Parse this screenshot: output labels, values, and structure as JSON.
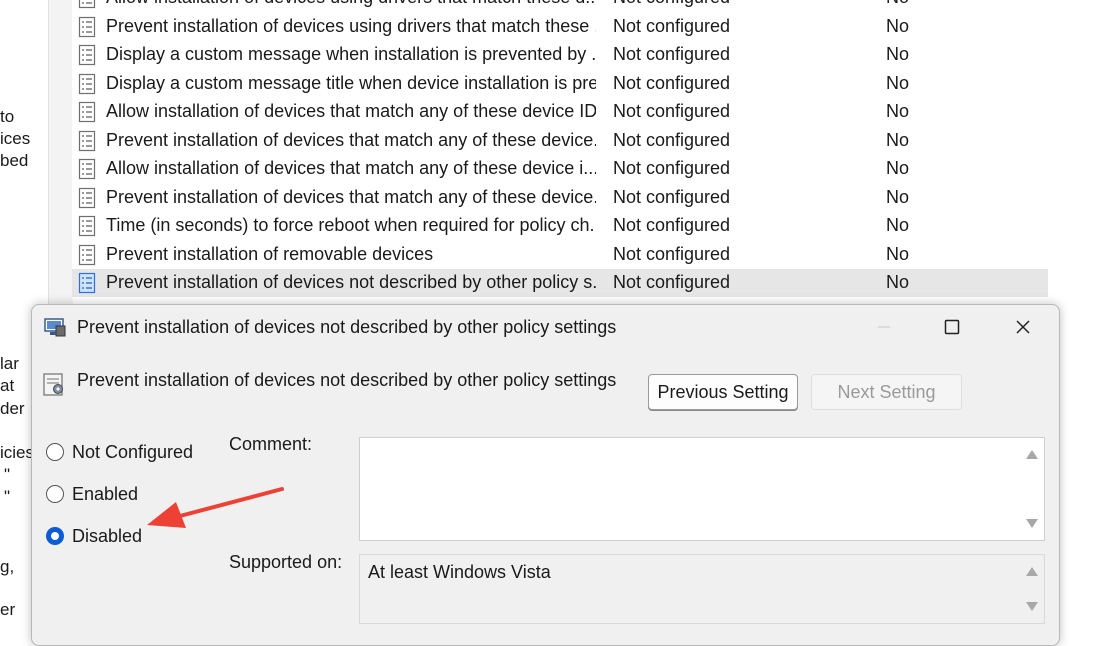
{
  "background_fragments": [
    {
      "text": "to"
    },
    {
      "text": "ices"
    },
    {
      "text": "bed"
    },
    {
      "text": "lar"
    },
    {
      "text": "at"
    },
    {
      "text": "der"
    },
    {
      "text": "icies"
    },
    {
      "text": "\""
    },
    {
      "text": "\""
    },
    {
      "text": "g,"
    },
    {
      "text": "er"
    }
  ],
  "policy_list": {
    "rows": [
      {
        "name": "Allow installation of devices using drivers that match these d...",
        "state": "Not configured",
        "comment": "No"
      },
      {
        "name": "Prevent installation of devices using drivers that match these ...",
        "state": "Not configured",
        "comment": "No"
      },
      {
        "name": "Display a custom message when installation is prevented by ...",
        "state": "Not configured",
        "comment": "No"
      },
      {
        "name": "Display a custom message title when device installation is pre...",
        "state": "Not configured",
        "comment": "No"
      },
      {
        "name": "Allow installation of devices that match any of these device IDs",
        "state": "Not configured",
        "comment": "No"
      },
      {
        "name": "Prevent installation of devices that match any of these device...",
        "state": "Not configured",
        "comment": "No"
      },
      {
        "name": "Allow installation of devices that match any of these device i...",
        "state": "Not configured",
        "comment": "No"
      },
      {
        "name": "Prevent installation of devices that match any of these device...",
        "state": "Not configured",
        "comment": "No"
      },
      {
        "name": "Time (in seconds) to force reboot when required for policy ch...",
        "state": "Not configured",
        "comment": "No"
      },
      {
        "name": "Prevent installation of removable devices",
        "state": "Not configured",
        "comment": "No"
      },
      {
        "name": "Prevent installation of devices not described by other policy s...",
        "state": "Not configured",
        "comment": "No",
        "selected": true
      }
    ]
  },
  "dialog": {
    "window_title": "Prevent installation of devices not described by other policy settings",
    "header_title": "Prevent installation of devices not described by other policy settings",
    "previous_button": "Previous Setting",
    "next_button": "Next Setting",
    "options": {
      "not_configured": "Not Configured",
      "enabled": "Enabled",
      "disabled": "Disabled",
      "selected": "Disabled"
    },
    "comment_label": "Comment:",
    "comment_value": "",
    "supported_label": "Supported on:",
    "supported_value": "At least Windows Vista"
  },
  "colors": {
    "accent": "#0b5cd6",
    "arrow": "#ee4135",
    "selected_row": "#e6e6e6",
    "dialog_bg": "#f0f0f0"
  },
  "icons": {
    "policy_row": "policy-setting-icon",
    "dialog": "group-policy-window-icon",
    "header": "policy-settings-icon",
    "annotation": "red-arrow"
  }
}
